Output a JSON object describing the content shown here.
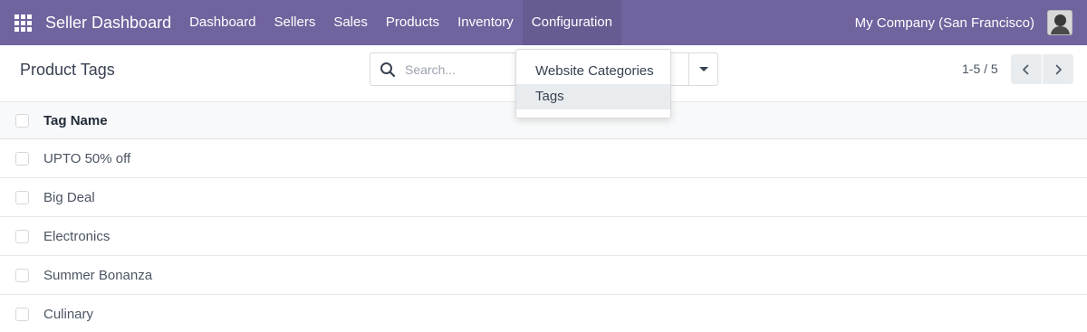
{
  "navbar": {
    "brand": "Seller Dashboard",
    "menu": [
      {
        "label": "Dashboard"
      },
      {
        "label": "Sellers"
      },
      {
        "label": "Sales"
      },
      {
        "label": "Products"
      },
      {
        "label": "Inventory"
      },
      {
        "label": "Configuration",
        "active": true
      }
    ],
    "company": "My Company (San Francisco)",
    "color": "#71639e"
  },
  "control_panel": {
    "title": "Product Tags",
    "search": {
      "placeholder": "Search...",
      "value": ""
    },
    "pager": {
      "value": "1-5 / 5"
    }
  },
  "dropdown": {
    "items": [
      {
        "label": "Website Categories"
      },
      {
        "label": "Tags",
        "highlighted": true
      }
    ]
  },
  "table": {
    "column": "Tag Name",
    "rows": [
      {
        "name": "UPTO 50% off"
      },
      {
        "name": "Big Deal"
      },
      {
        "name": "Electronics"
      },
      {
        "name": "Summer Bonanza"
      },
      {
        "name": "Culinary"
      }
    ]
  },
  "icons": {
    "apps": "apps-grid-icon",
    "search": "search-icon",
    "caret": "caret-down-icon",
    "prev": "chevron-left-icon",
    "next": "chevron-right-icon"
  }
}
